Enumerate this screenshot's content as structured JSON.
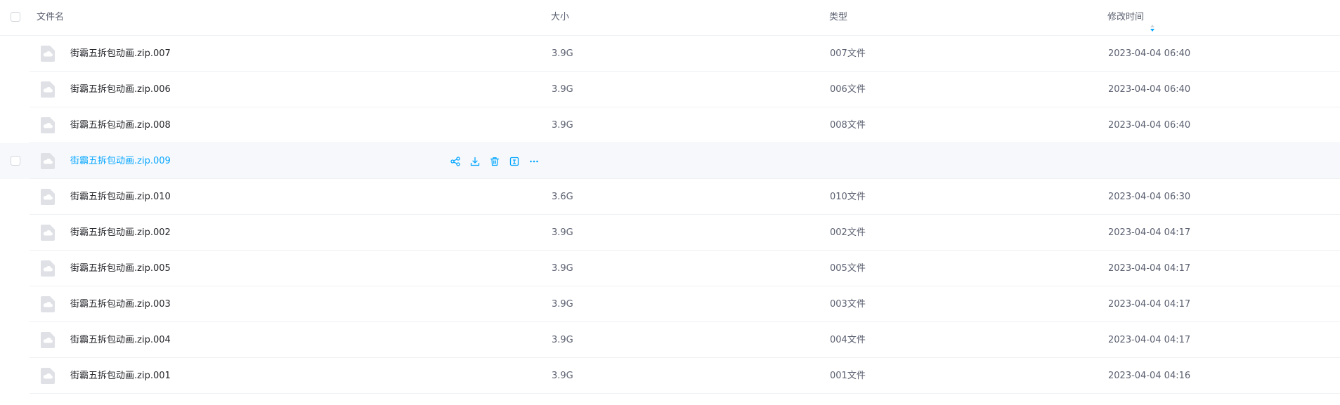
{
  "header": {
    "name": "文件名",
    "size": "大小",
    "type": "类型",
    "modified": "修改时间"
  },
  "colors": {
    "accent": "#06a7ff",
    "text": "#25262b",
    "muted": "#5b6070",
    "hover_row": "#f6f8fc"
  },
  "hover_actions": [
    "share-icon",
    "download-icon",
    "delete-icon",
    "info-icon",
    "more-icon"
  ],
  "rows": [
    {
      "name": "街霸五拆包动画.zip.007",
      "size": "3.9G",
      "type": "007文件",
      "modified": "2023-04-04 06:40"
    },
    {
      "name": "街霸五拆包动画.zip.006",
      "size": "3.9G",
      "type": "006文件",
      "modified": "2023-04-04 06:40"
    },
    {
      "name": "街霸五拆包动画.zip.008",
      "size": "3.9G",
      "type": "008文件",
      "modified": "2023-04-04 06:40"
    },
    {
      "name": "街霸五拆包动画.zip.009",
      "size": "",
      "type": "",
      "modified": ""
    },
    {
      "name": "街霸五拆包动画.zip.010",
      "size": "3.6G",
      "type": "010文件",
      "modified": "2023-04-04 06:30"
    },
    {
      "name": "街霸五拆包动画.zip.002",
      "size": "3.9G",
      "type": "002文件",
      "modified": "2023-04-04 04:17"
    },
    {
      "name": "街霸五拆包动画.zip.005",
      "size": "3.9G",
      "type": "005文件",
      "modified": "2023-04-04 04:17"
    },
    {
      "name": "街霸五拆包动画.zip.003",
      "size": "3.9G",
      "type": "003文件",
      "modified": "2023-04-04 04:17"
    },
    {
      "name": "街霸五拆包动画.zip.004",
      "size": "3.9G",
      "type": "004文件",
      "modified": "2023-04-04 04:17"
    },
    {
      "name": "街霸五拆包动画.zip.001",
      "size": "3.9G",
      "type": "001文件",
      "modified": "2023-04-04 04:16"
    }
  ]
}
